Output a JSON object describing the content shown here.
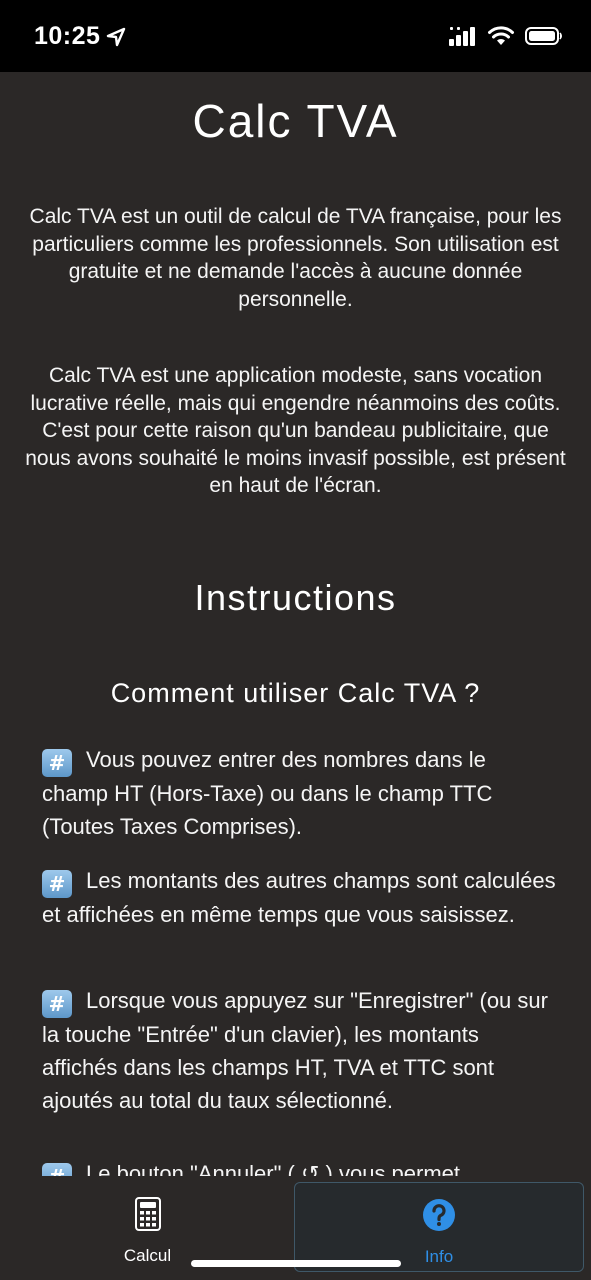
{
  "status_bar": {
    "time": "10:25",
    "icons": [
      "location-arrow-icon",
      "cellular-signal-icon",
      "wifi-icon",
      "battery-icon"
    ]
  },
  "main": {
    "title": "Calc TVA",
    "paragraph_1": "Calc TVA est un outil de calcul de TVA française, pour les particuliers comme les professionnels. Son utilisation est gratuite et ne demande l'accès à aucune donnée personnelle.",
    "paragraph_2_lines": [
      "Calc TVA est une application modeste, sans vocation lucrative réelle, mais qui engendre néanmoins des coûts.",
      "C'est pour cette raison qu'un bandeau publicitaire, que nous avons souhaité le moins invasif possible, est présent en haut de l'écran."
    ],
    "section_title": "Instructions",
    "subsection_title": "Comment utiliser Calc TVA ?",
    "instructions": [
      "Vous pouvez entrer des nombres dans le champ HT (Hors-Taxe) ou dans le champ TTC (Toutes Taxes Comprises).",
      "Les montants des autres champs sont calculées et affichées en même temps que vous saisissez.",
      "Lorsque vous appuyez sur \"Enregistrer\" (ou sur la touche \"Entrée\" d'un clavier), les montants affichés dans les champs HT, TVA et TTC sont ajoutés au total du taux sélectionné.",
      "Le bouton \"Annuler\" ( ↺ ) vous permet"
    ],
    "bullet_icon_glyph": "#"
  },
  "tab_bar": {
    "tabs": [
      {
        "label": "Calcul",
        "icon": "calculator-icon",
        "selected": false
      },
      {
        "label": "Info",
        "icon": "question-circle-icon",
        "selected": true
      }
    ]
  },
  "colors": {
    "background": "#2b2827",
    "status_bar": "#000000",
    "accent": "#2f8fe6",
    "bullet_icon": "#6fa5d6"
  }
}
